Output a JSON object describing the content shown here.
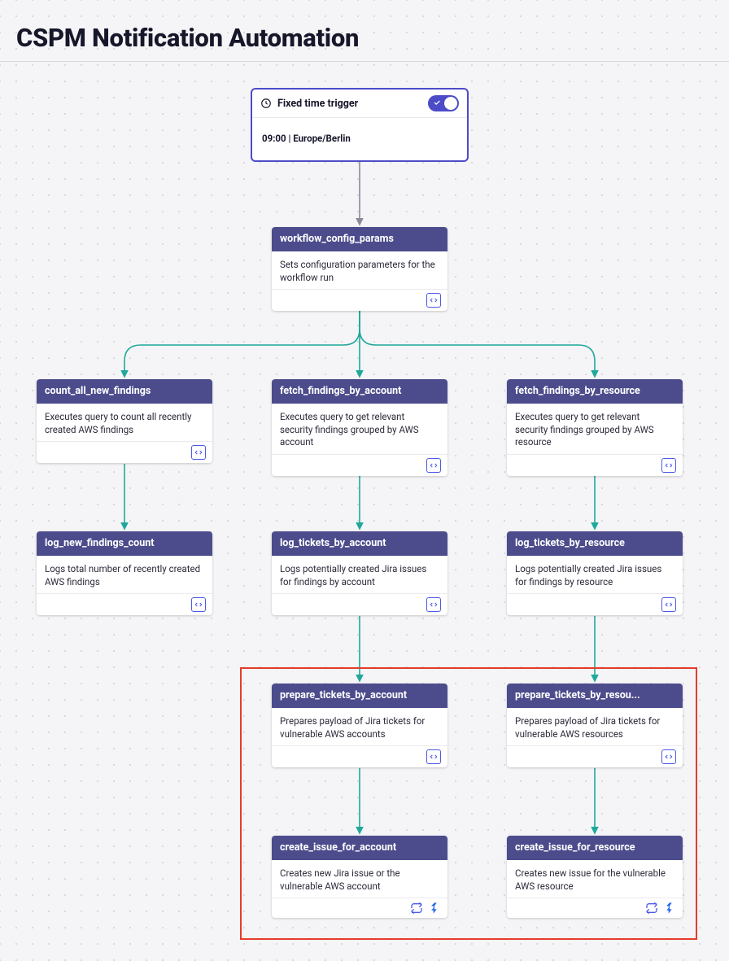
{
  "page": {
    "title": "CSPM Notification Automation"
  },
  "trigger": {
    "label": "Fixed time trigger",
    "schedule": "09:00 | Europe/Berlin",
    "enabled": true
  },
  "nodes": {
    "workflow_config": {
      "title": "workflow_config_params",
      "desc": "Sets configuration parameters for the workflow run"
    },
    "count_all": {
      "title": "count_all_new_findings",
      "desc": "Executes query to count all recently created AWS findings"
    },
    "fetch_by_account": {
      "title": "fetch_findings_by_account",
      "desc": "Executes query to get relevant security findings grouped by AWS account"
    },
    "fetch_by_resource": {
      "title": "fetch_findings_by_resource",
      "desc": "Executes query to get relevant security findings grouped by AWS resource"
    },
    "log_count": {
      "title": "log_new_findings_count",
      "desc": "Logs total number of recently created AWS findings"
    },
    "log_by_account": {
      "title": "log_tickets_by_account",
      "desc": "Logs potentially created Jira issues for findings by account"
    },
    "log_by_resource": {
      "title": "log_tickets_by_resource",
      "desc": "Logs potentially created Jira issues for findings by resource"
    },
    "prepare_by_account": {
      "title": "prepare_tickets_by_account",
      "desc": "Prepares payload of Jira tickets for vulnerable AWS accounts"
    },
    "prepare_by_resource": {
      "title": "prepare_tickets_by_resou...",
      "desc": "Prepares payload of Jira tickets for vulnerable AWS resources"
    },
    "create_account": {
      "title": "create_issue_for_account",
      "desc": "Creates new Jira issue or the vulnerable AWS account"
    },
    "create_resource": {
      "title": "create_issue_for_resource",
      "desc": "Creates new issue for the vulnerable AWS resource"
    }
  }
}
